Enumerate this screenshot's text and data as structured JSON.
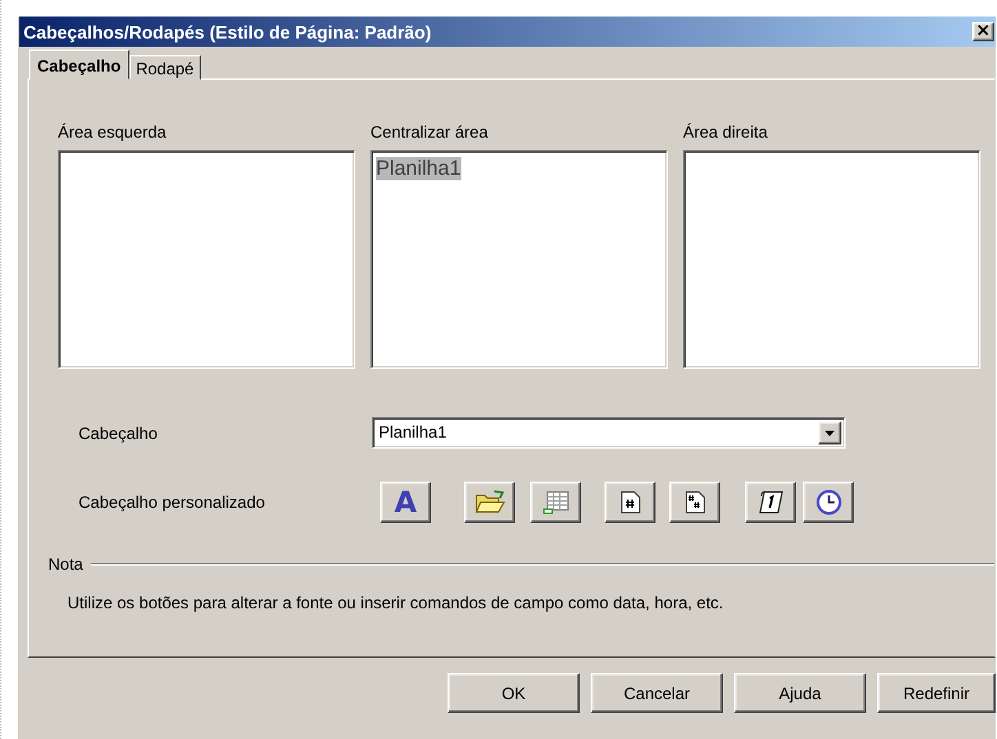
{
  "window": {
    "title": "Cabeçalhos/Rodapés (Estilo de Página: Padrão)",
    "close": "×"
  },
  "tabs": [
    {
      "label": "Cabeçalho",
      "selected": true
    },
    {
      "label": "Rodapé",
      "selected": false
    }
  ],
  "areas": [
    {
      "label": "Área esquerda"
    },
    {
      "label": "Centralizar área",
      "text": "Planilha1",
      "highlighted": true
    },
    {
      "label": "Área direita"
    }
  ],
  "header": {
    "label": "Cabeçalho",
    "value": "Planilha1"
  },
  "custom_header": {
    "label": "Cabeçalho personalizado",
    "tools": [
      {
        "kind": "font",
        "glyph": "A"
      },
      {
        "kind": "file"
      },
      {
        "kind": "sheet"
      },
      {
        "kind": "page"
      },
      {
        "kind": "pages"
      },
      {
        "kind": "date"
      },
      {
        "kind": "time"
      }
    ]
  },
  "note": {
    "title": "Nota",
    "text": "Utilize os botões para alterar a fonte ou inserir comandos de campo como data, hora, etc."
  },
  "buttons": [
    "OK",
    "Cancelar",
    "Ajuda",
    "Redefinir"
  ]
}
